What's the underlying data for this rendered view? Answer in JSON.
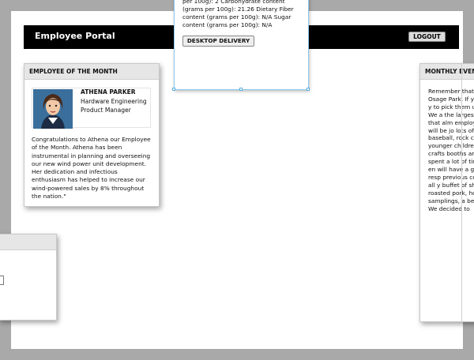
{
  "header": {
    "title": "Employee Portal",
    "logout_label": "LOGOUT"
  },
  "employee_of_month": {
    "heading": "EMPLOYEE OF THE MONTH",
    "name": "ATHENA PARKER",
    "department": "Hardware Engineering",
    "role": "Product Manager",
    "description": "Congratulations to Athena our Employee of the Month. Athena has been instrumental in planning and overseeing our new wind power unit development. Her dedication and infectious enthusiasm has helped to increase our wind-powered sales by 8% throughout the nation.\""
  },
  "monthly_events": {
    "heading": "MONTHLY EVENTS",
    "text": "Remember that company picnic Osage Park. If y up your tickets y to pick them up than 3 PM. We a the largest turn excited that alm employees and friends will be jo lots of different a baseball, rock c swimming and younger childre painting, balloo crafts booths ar Sally L., Lucy B. spent a lot of tim the events to en will have a grea to the great resp previous compa offering an all y buffet of short ri mignon, roasted pork, hot dogs, samplings, a be vegetarian dish We decided to"
  },
  "popup": {
    "nutrition_text": "per 100g): 2 Carbohydrate content (grams per 100g): 21.26 Dietary Fiber content (grams per 100g): N/A Sugar content (grams per 100g): N/A",
    "button_label": "DESKTOP DELIVERY"
  },
  "colors": {
    "header_bg": "#000000",
    "page_bg": "#ffffff",
    "backdrop": "#a9a9a9",
    "panel_header": "#e6e6e6",
    "selection_border": "#8cc8e8"
  }
}
